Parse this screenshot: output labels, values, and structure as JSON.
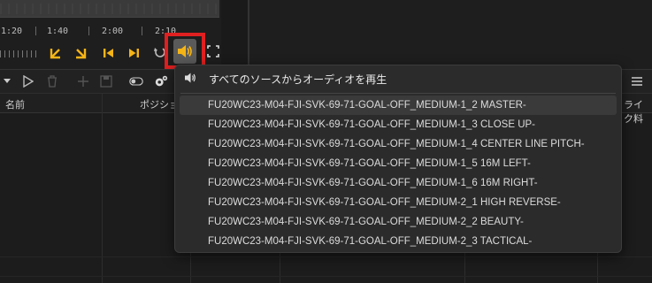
{
  "timeline": {
    "time_labels": [
      "1:20",
      "1:40",
      "2:00",
      "2:10"
    ]
  },
  "table": {
    "col_name": "名前",
    "col_position": "ポジショ",
    "col_right": "ライク料"
  },
  "audio_menu": {
    "header": "すべてのソースからオーディオを再生",
    "items": [
      "FU20WC23-M04-FJI-SVK-69-71-GOAL-OFF_MEDIUM-1_2 MASTER-",
      "FU20WC23-M04-FJI-SVK-69-71-GOAL-OFF_MEDIUM-1_3 CLOSE UP-",
      "FU20WC23-M04-FJI-SVK-69-71-GOAL-OFF_MEDIUM-1_4 CENTER LINE PITCH-",
      "FU20WC23-M04-FJI-SVK-69-71-GOAL-OFF_MEDIUM-1_5 16M LEFT-",
      "FU20WC23-M04-FJI-SVK-69-71-GOAL-OFF_MEDIUM-1_6 16M RIGHT-",
      "FU20WC23-M04-FJI-SVK-69-71-GOAL-OFF_MEDIUM-2_1 HIGH REVERSE-",
      "FU20WC23-M04-FJI-SVK-69-71-GOAL-OFF_MEDIUM-2_2 BEAUTY-",
      "FU20WC23-M04-FJI-SVK-69-71-GOAL-OFF_MEDIUM-2_3 TACTICAL-"
    ]
  },
  "icons": {
    "volume": "speaker-icon",
    "accent_yellow": "#f5b416",
    "highlight_red": "#e02020"
  }
}
